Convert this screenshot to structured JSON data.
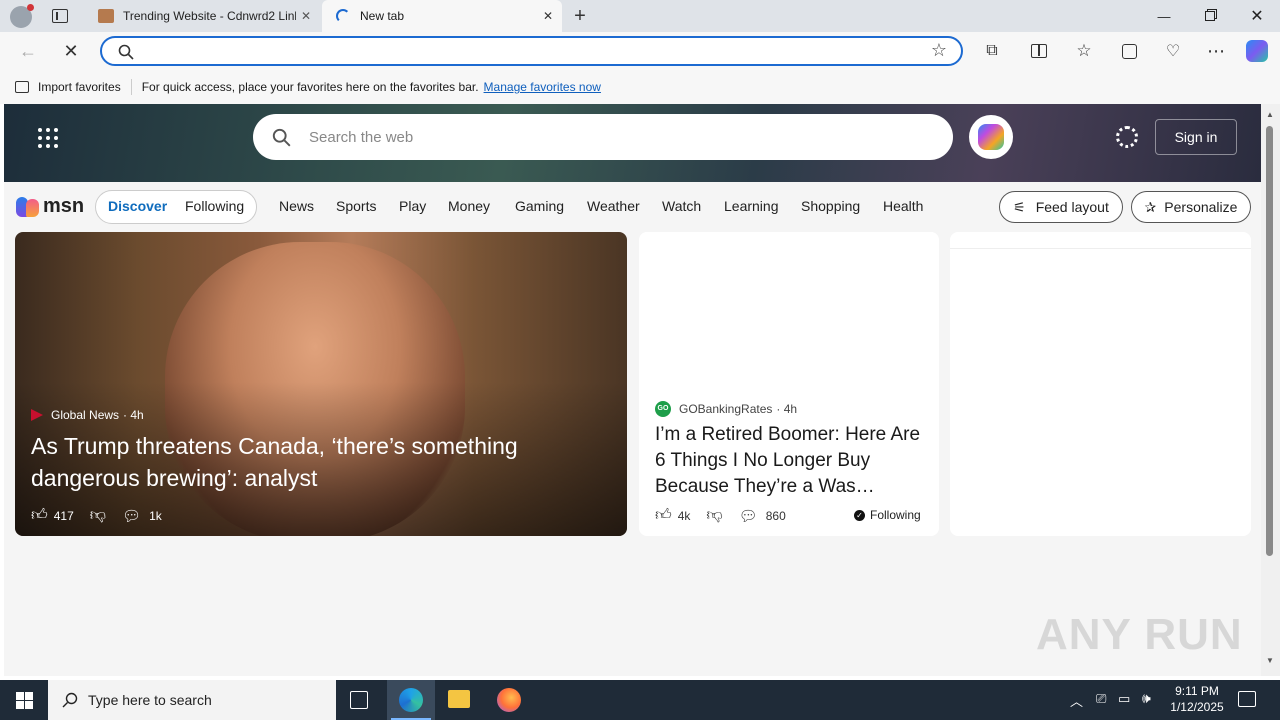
{
  "tabs": [
    {
      "title": "Trending Website - Cdnwrd2 Link",
      "close": "✕"
    },
    {
      "title": "New tab",
      "close": "✕"
    }
  ],
  "favbar": {
    "import_label": "Import favorites",
    "hint": "For quick access, place your favorites here on the favorites bar.",
    "manage_link": "Manage favorites now"
  },
  "msn": {
    "logo": "msn",
    "search_placeholder": "Search the web",
    "signin": "Sign in",
    "discover": "Discover",
    "following": "Following",
    "categories": [
      "News",
      "Sports",
      "Play",
      "Money",
      "Gaming",
      "Weather",
      "Watch",
      "Learning",
      "Shopping",
      "Health"
    ],
    "feed_layout": "Feed layout",
    "personalize": "Personalize"
  },
  "cards": [
    {
      "source": "Global News",
      "age": "· 4h",
      "headline": "As Trump threatens Canada, ‘there’s something dangerous brewing’: analyst",
      "likes": "417",
      "comments": "1k"
    },
    {
      "source": "GOBankingRates",
      "age": "· 4h",
      "headline": "I’m a Retired Boomer: Here Are 6 Things I No Longer Buy Because They’re a Was…",
      "likes": "4k",
      "comments": "860",
      "follow_status": "Following"
    }
  ],
  "taskbar": {
    "search_placeholder": "Type here to search",
    "time": "9:11 PM",
    "date": "1/12/2025"
  },
  "watermark": "ANY RUN",
  "colors": {
    "accent": "#1c6ad1",
    "msn_blue": "#0f6cbd",
    "taskbar": "#1f2b38"
  }
}
